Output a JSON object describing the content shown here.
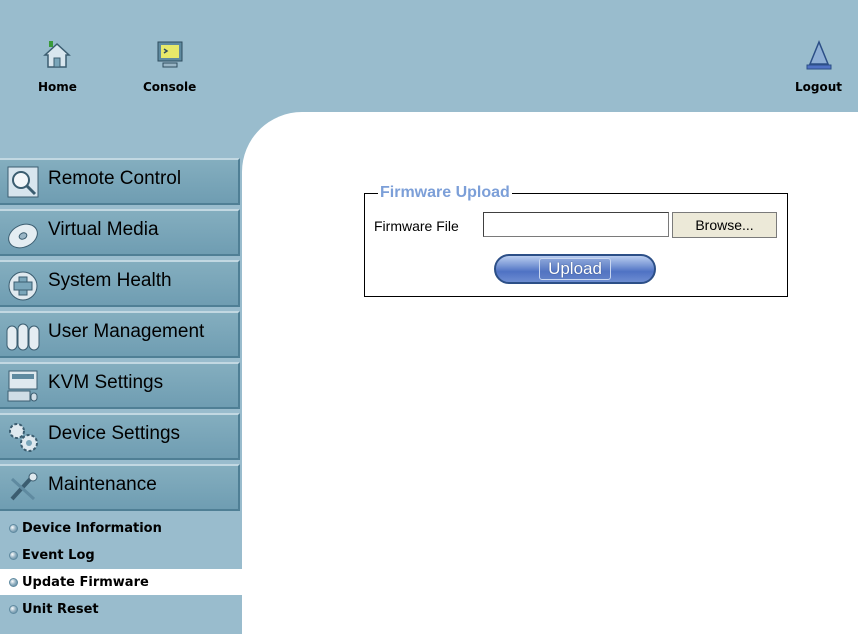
{
  "topnav": {
    "home_label": "Home",
    "console_label": "Console",
    "logout_label": "Logout"
  },
  "sidebar": {
    "items": [
      {
        "label": "Remote Control",
        "icon": "magnifier-icon"
      },
      {
        "label": "Virtual Media",
        "icon": "disc-icon"
      },
      {
        "label": "System Health",
        "icon": "health-cross-icon"
      },
      {
        "label": "User Management",
        "icon": "users-icon"
      },
      {
        "label": "KVM Settings",
        "icon": "keyboard-monitor-icon"
      },
      {
        "label": "Device Settings",
        "icon": "gears-icon"
      },
      {
        "label": "Maintenance",
        "icon": "tools-icon"
      }
    ],
    "subitems": [
      {
        "label": "Device Information",
        "active": false
      },
      {
        "label": "Event Log",
        "active": false
      },
      {
        "label": "Update Firmware",
        "active": true
      },
      {
        "label": "Unit Reset",
        "active": false
      }
    ]
  },
  "firmware": {
    "legend": "Firmware Upload",
    "file_label": "Firmware File",
    "file_value": "",
    "browse_label": "Browse...",
    "upload_label": "Upload"
  },
  "colors": {
    "header_bg": "#99bccd",
    "menu_bg": "#7aa6ba",
    "legend": "#7c9fd8",
    "upload_button": "#4f72c4"
  }
}
